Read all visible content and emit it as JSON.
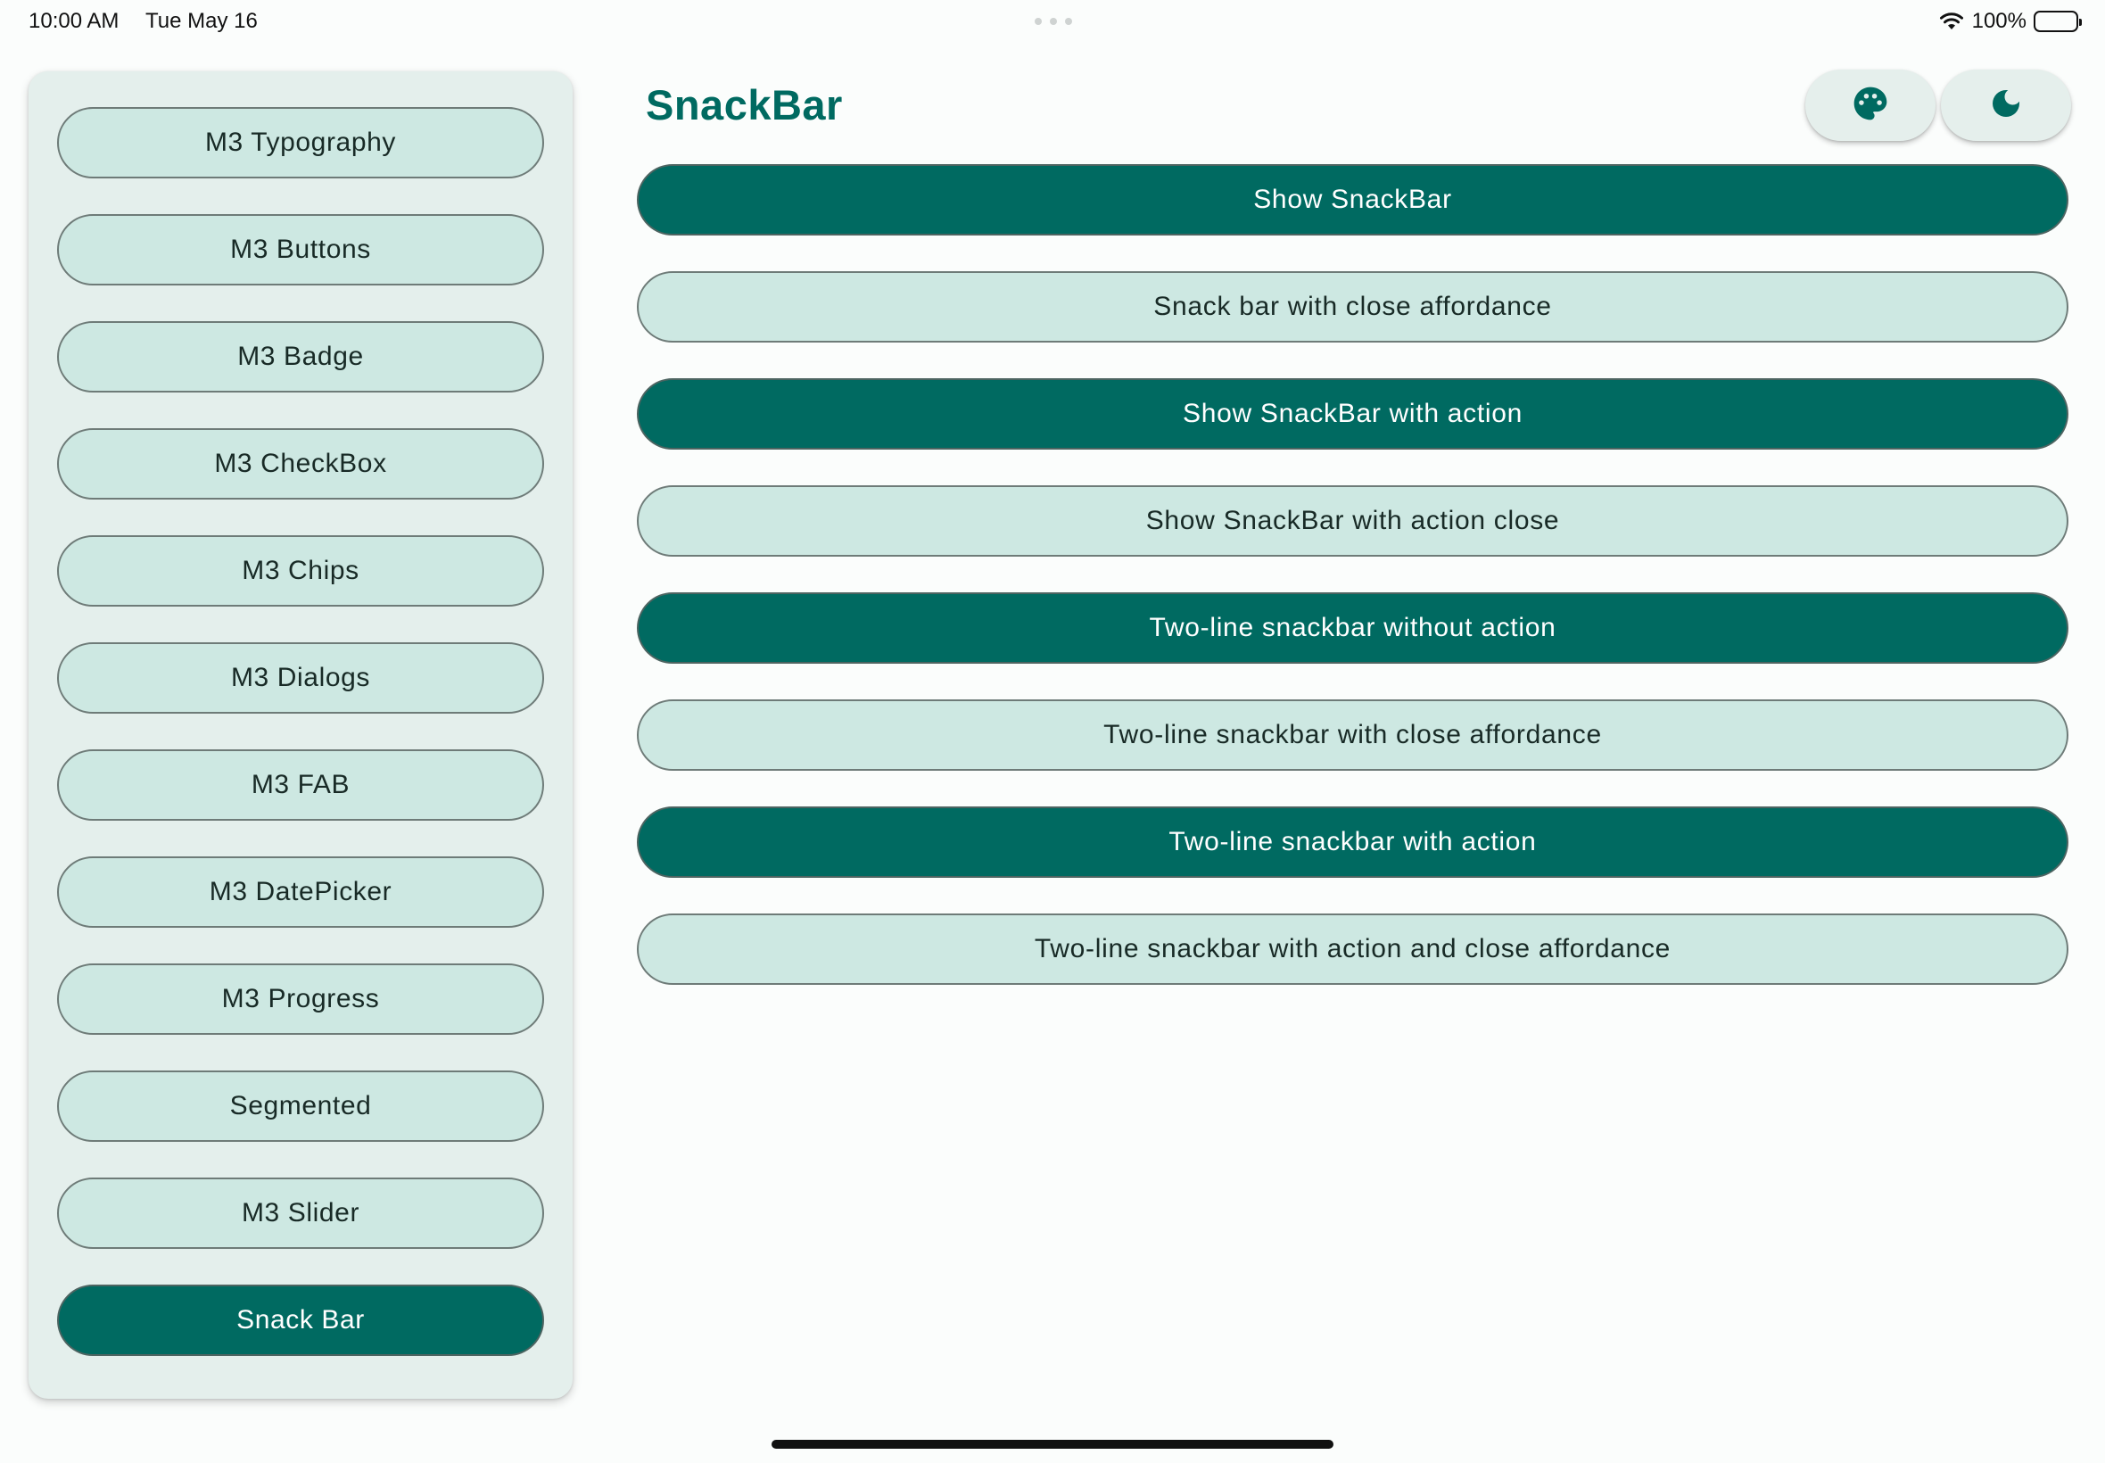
{
  "status_bar": {
    "time": "10:00 AM",
    "date": "Tue May 16",
    "battery": "100%"
  },
  "sidebar": {
    "items": [
      {
        "label": "M3 Typography",
        "active": false
      },
      {
        "label": "M3 Buttons",
        "active": false
      },
      {
        "label": "M3 Badge",
        "active": false
      },
      {
        "label": "M3 CheckBox",
        "active": false
      },
      {
        "label": "M3 Chips",
        "active": false
      },
      {
        "label": "M3 Dialogs",
        "active": false
      },
      {
        "label": "M3 FAB",
        "active": false
      },
      {
        "label": "M3 DatePicker",
        "active": false
      },
      {
        "label": "M3 Progress",
        "active": false
      },
      {
        "label": "Segmented",
        "active": false
      },
      {
        "label": "M3 Slider",
        "active": false
      },
      {
        "label": "Snack Bar",
        "active": true
      }
    ]
  },
  "header": {
    "title": "SnackBar",
    "actions": [
      {
        "icon": "palette-icon"
      },
      {
        "icon": "moon-icon"
      }
    ]
  },
  "main": {
    "buttons": [
      {
        "label": "Show SnackBar",
        "style": "filled"
      },
      {
        "label": "Snack bar with close affordance",
        "style": "tonal"
      },
      {
        "label": "Show SnackBar with action",
        "style": "filled"
      },
      {
        "label": "Show SnackBar with action close",
        "style": "tonal"
      },
      {
        "label": "Two-line snackbar without action",
        "style": "filled"
      },
      {
        "label": "Two-line snackbar with close affordance",
        "style": "tonal"
      },
      {
        "label": "Two-line snackbar with action",
        "style": "filled"
      },
      {
        "label": "Two-line snackbar with action and close affordance",
        "style": "tonal"
      }
    ]
  },
  "colors": {
    "primary": "#006a61",
    "tonal": "#cde8e2",
    "surface": "#e4efec",
    "background": "#fbfdfc"
  }
}
